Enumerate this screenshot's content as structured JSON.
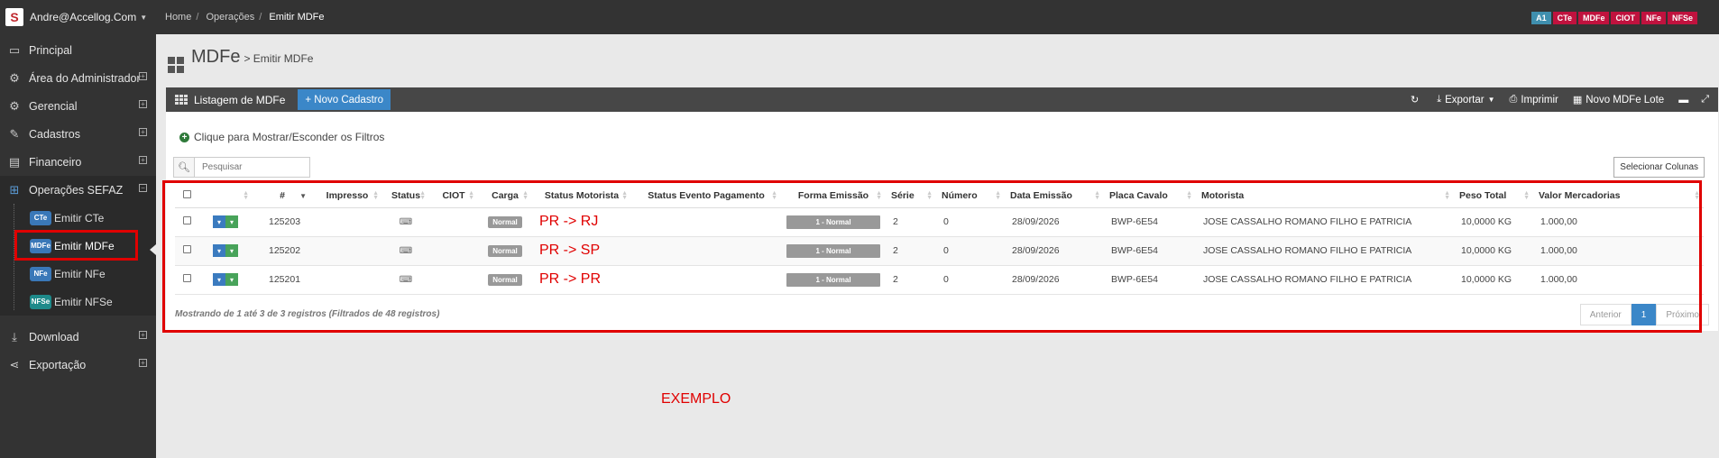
{
  "sidebar": {
    "user": "Andre@Accellog.Com",
    "items": [
      {
        "label": "Principal",
        "icon": "monitor-icon",
        "expandable": false
      },
      {
        "label": "Área do Administrador",
        "icon": "gears-icon",
        "expandable": true
      },
      {
        "label": "Gerencial",
        "icon": "gears-icon",
        "expandable": true
      },
      {
        "label": "Cadastros",
        "icon": "edit-icon",
        "expandable": true
      },
      {
        "label": "Financeiro",
        "icon": "money-icon",
        "expandable": true
      },
      {
        "label": "Operações SEFAZ",
        "icon": "windows-icon",
        "expandable": true,
        "open": true
      }
    ],
    "subitems": [
      {
        "label": "Emitir CTe",
        "icon_text": "CTe"
      },
      {
        "label": "Emitir MDFe",
        "icon_text": "MDFe",
        "active": true
      },
      {
        "label": "Emitir NFe",
        "icon_text": "NFe"
      },
      {
        "label": "Emitir NFSe",
        "icon_text": "NFSe"
      }
    ],
    "bottom_items": [
      {
        "label": "Download",
        "icon": "download-icon"
      },
      {
        "label": "Exportação",
        "icon": "share-icon"
      }
    ]
  },
  "topbar": {
    "breadcrumb": [
      "Home",
      "Operações",
      "Emitir MDFe"
    ],
    "badges": [
      "A1",
      "CTe",
      "MDFe",
      "CIOT",
      "NFe",
      "NFSe"
    ]
  },
  "page": {
    "title": "MDFe",
    "subtitle": "> Emitir MDFe"
  },
  "panel": {
    "title": "Listagem de MDFe",
    "new_button": "+ Novo Cadastro",
    "actions": [
      "Exportar",
      "Imprimir",
      "Novo MDFe Lote"
    ],
    "filter_toggle": "Clique para Mostrar/Esconder os Filtros",
    "search_placeholder": "Pesquisar",
    "select_columns": "Selecionar Colunas"
  },
  "table": {
    "columns": [
      "#",
      "Impresso",
      "Status",
      "CIOT",
      "Carga",
      "Status Motorista",
      "Status Evento Pagamento",
      "Forma Emissão",
      "Série",
      "Número",
      "Data Emissão",
      "Placa Cavalo",
      "Motorista",
      "Peso Total",
      "Valor Mercadorias"
    ],
    "rows": [
      {
        "id": "125203",
        "carga": "Normal",
        "status_motorista": "PR -> RJ",
        "forma": "1 - Normal",
        "serie": "2",
        "numero": "0",
        "data": "28/09/2026",
        "placa": "BWP-6E54",
        "motorista": "JOSE CASSALHO ROMANO FILHO E PATRICIA",
        "peso": "10,0000 KG",
        "valor": "1.000,00"
      },
      {
        "id": "125202",
        "carga": "Normal",
        "status_motorista": "PR -> SP",
        "forma": "1 - Normal",
        "serie": "2",
        "numero": "0",
        "data": "28/09/2026",
        "placa": "BWP-6E54",
        "motorista": "JOSE CASSALHO ROMANO FILHO E PATRICIA",
        "peso": "10,0000 KG",
        "valor": "1.000,00"
      },
      {
        "id": "125201",
        "carga": "Normal",
        "status_motorista": "PR -> PR",
        "forma": "1 - Normal",
        "serie": "2",
        "numero": "0",
        "data": "28/09/2026",
        "placa": "BWP-6E54",
        "motorista": "JOSE CASSALHO ROMANO FILHO E PATRICIA",
        "peso": "10,0000 KG",
        "valor": "1.000,00"
      }
    ],
    "footer": "Mostrando de 1 até 3 de 3 registros (Filtrados de 48 registros)",
    "pager": {
      "prev": "Anterior",
      "current": "1",
      "next": "Próximo"
    }
  },
  "annotation": "EXEMPLO"
}
